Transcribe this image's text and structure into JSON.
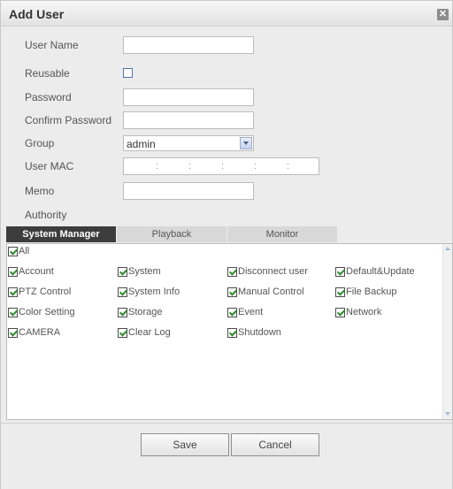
{
  "dialog": {
    "title": "Add User",
    "close_icon": "close-icon"
  },
  "form": {
    "user_name": {
      "label": "User Name",
      "value": ""
    },
    "reusable": {
      "label": "Reusable",
      "checked": false
    },
    "password": {
      "label": "Password",
      "value": ""
    },
    "confirm_password": {
      "label": "Confirm Password",
      "value": ""
    },
    "group": {
      "label": "Group",
      "value": "admin"
    },
    "user_mac": {
      "label": "User MAC",
      "separator": ":"
    },
    "memo": {
      "label": "Memo",
      "value": ""
    },
    "authority": {
      "label": "Authority"
    }
  },
  "tabs": [
    "System Manager",
    "Playback",
    "Monitor"
  ],
  "authority": {
    "all_label": "All",
    "permissions": [
      "Account",
      "System",
      "Disconnect user",
      "Default&Update",
      "PTZ Control",
      "System Info",
      "Manual Control",
      "File Backup",
      "Color Setting",
      "Storage",
      "Event",
      "Network",
      "CAMERA",
      "Clear Log",
      "Shutdown"
    ]
  },
  "buttons": {
    "save": "Save",
    "cancel": "Cancel"
  },
  "colors": {
    "active_tab": "#3d3d3d",
    "check_mark": "#2f8a2f",
    "panel_bg": "#ececec"
  }
}
